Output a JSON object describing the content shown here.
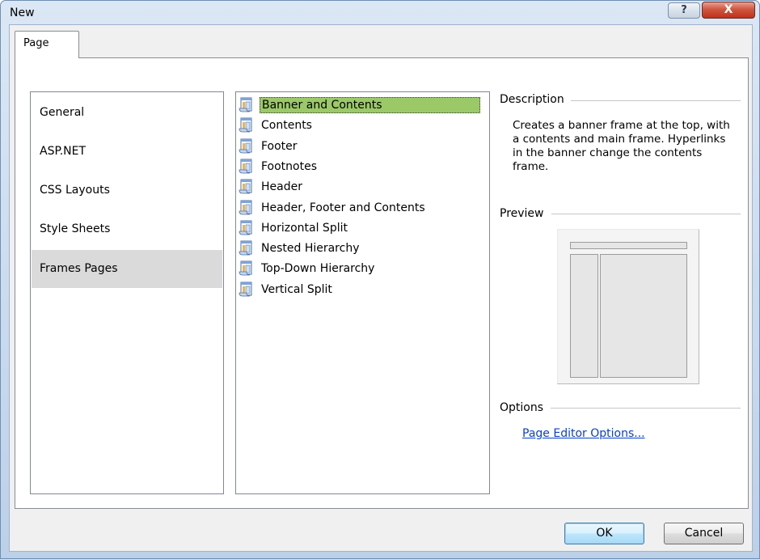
{
  "window": {
    "title": "New",
    "help_glyph": "?",
    "close_glyph": "X"
  },
  "tabs": [
    {
      "label": "Page"
    }
  ],
  "categories": [
    {
      "label": "General"
    },
    {
      "label": "ASP.NET"
    },
    {
      "label": "CSS Layouts"
    },
    {
      "label": "Style Sheets"
    },
    {
      "label": "Frames Pages",
      "selected": true
    }
  ],
  "templates": [
    {
      "label": "Banner and Contents",
      "selected": true
    },
    {
      "label": "Contents"
    },
    {
      "label": "Footer"
    },
    {
      "label": "Footnotes"
    },
    {
      "label": "Header"
    },
    {
      "label": "Header, Footer and Contents"
    },
    {
      "label": "Horizontal Split"
    },
    {
      "label": "Nested Hierarchy"
    },
    {
      "label": "Top-Down Hierarchy"
    },
    {
      "label": "Vertical Split"
    }
  ],
  "description": {
    "label": "Description",
    "text": "Creates a banner frame at the top, with a contents and main frame. Hyperlinks in the banner change the contents frame."
  },
  "preview": {
    "label": "Preview"
  },
  "options": {
    "label": "Options",
    "link_text": "Page Editor Options..."
  },
  "buttons": {
    "ok": "OK",
    "cancel": "Cancel"
  },
  "colors": {
    "selection_green": "#9bc968",
    "link_blue": "#0a3fd0",
    "category_selected": "#dadada"
  }
}
